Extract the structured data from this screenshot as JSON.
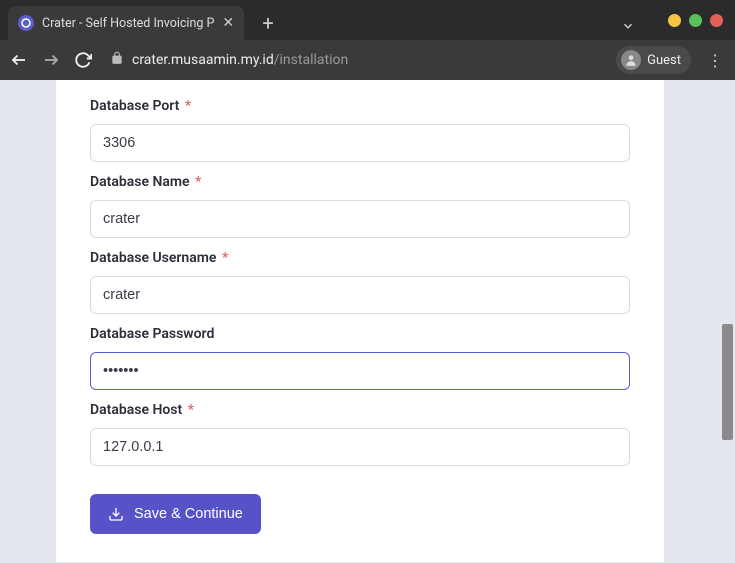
{
  "browser": {
    "tab_title": "Crater - Self Hosted Invoicing P",
    "url_host": "crater.musaamin.my.id",
    "url_path": "/installation",
    "guest_label": "Guest"
  },
  "form": {
    "db_port": {
      "label": "Database Port",
      "required": true,
      "value": "3306"
    },
    "db_name": {
      "label": "Database Name",
      "required": true,
      "value": "crater"
    },
    "db_username": {
      "label": "Database Username",
      "required": true,
      "value": "crater"
    },
    "db_password": {
      "label": "Database Password",
      "required": false,
      "value": "•••••••"
    },
    "db_host": {
      "label": "Database Host",
      "required": true,
      "value": "127.0.0.1"
    },
    "submit_label": "Save & Continue"
  },
  "colors": {
    "accent": "#5852c9",
    "required": "#e06767"
  }
}
